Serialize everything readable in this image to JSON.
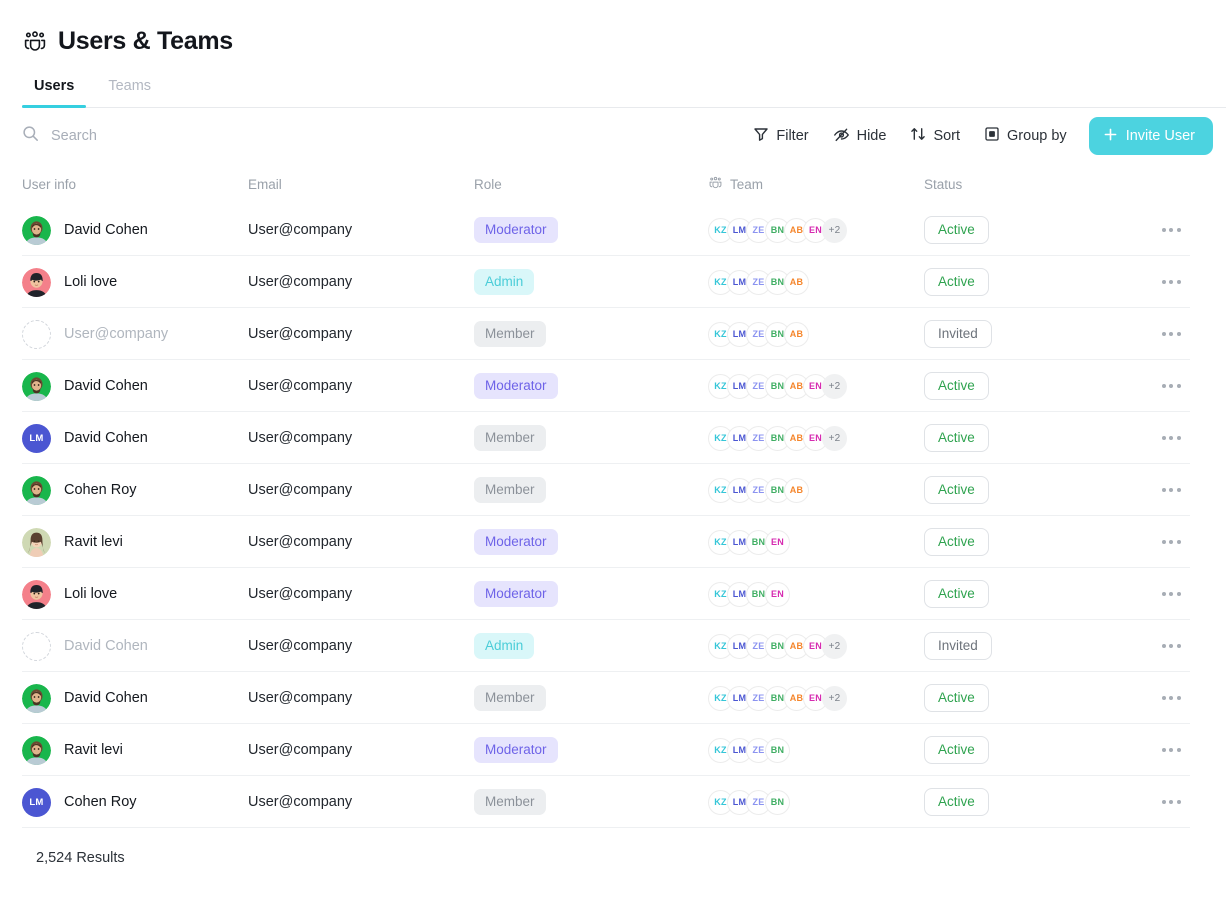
{
  "header": {
    "title": "Users & Teams",
    "icon": "users-group-icon"
  },
  "tabs": [
    {
      "label": "Users",
      "active": true
    },
    {
      "label": "Teams",
      "active": false
    }
  ],
  "search": {
    "placeholder": "Search",
    "value": "",
    "icon": "search-icon"
  },
  "toolbar": {
    "filter_label": "Filter",
    "hide_label": "Hide",
    "sort_label": "Sort",
    "group_label": "Group by",
    "invite_label": "Invite User"
  },
  "colors": {
    "accent": "#4cd3e0",
    "tab_underline": "#35cfe0",
    "role_moderator_bg": "#e6e4fd",
    "role_moderator_fg": "#6e63e8",
    "role_admin_bg": "#d9f7f9",
    "role_admin_fg": "#4bcdd8",
    "role_member_bg": "#eceef0",
    "role_member_fg": "#8b9199",
    "status_active": "#2fa34f",
    "status_invited": "#6d737b"
  },
  "team_colors": {
    "KZ": "#35c6d8",
    "LM": "#4b56d2",
    "ZE": "#8b93f0",
    "BN": "#3fae63",
    "AB": "#f5862c",
    "EN": "#d62bb0"
  },
  "table": {
    "columns": [
      {
        "key": "user",
        "label": "User info"
      },
      {
        "key": "email",
        "label": "Email"
      },
      {
        "key": "role",
        "label": "Role"
      },
      {
        "key": "team",
        "label": "Team",
        "icon": "users-group-icon"
      },
      {
        "key": "status",
        "label": "Status"
      }
    ],
    "row_menu_icon": "kebab-menu-icon",
    "rows": [
      {
        "name": "David Cohen",
        "avatar": "photo-man-green",
        "muted": false,
        "email": "User@company",
        "role": "Moderator",
        "teams": [
          "KZ",
          "LM",
          "ZE",
          "BN",
          "AB",
          "EN"
        ],
        "more": "+2",
        "status": "Active"
      },
      {
        "name": "Loli love",
        "avatar": "photo-woman-pink",
        "muted": false,
        "email": "User@company",
        "role": "Admin",
        "teams": [
          "KZ",
          "LM",
          "ZE",
          "BN",
          "AB"
        ],
        "more": "",
        "status": "Active"
      },
      {
        "name": "User@company",
        "avatar": "placeholder",
        "muted": true,
        "email": "User@company",
        "role": "Member",
        "teams": [
          "KZ",
          "LM",
          "ZE",
          "BN",
          "AB"
        ],
        "more": "",
        "status": "Invited"
      },
      {
        "name": "David Cohen",
        "avatar": "photo-man-green",
        "muted": false,
        "email": "User@company",
        "role": "Moderator",
        "teams": [
          "KZ",
          "LM",
          "ZE",
          "BN",
          "AB",
          "EN"
        ],
        "more": "+2",
        "status": "Active"
      },
      {
        "name": "David Cohen",
        "avatar": "initials-LM",
        "muted": false,
        "email": "User@company",
        "role": "Member",
        "teams": [
          "KZ",
          "LM",
          "ZE",
          "BN",
          "AB",
          "EN"
        ],
        "more": "+2",
        "status": "Active"
      },
      {
        "name": "Cohen Roy",
        "avatar": "photo-man-green",
        "muted": false,
        "email": "User@company",
        "role": "Member",
        "teams": [
          "KZ",
          "LM",
          "ZE",
          "BN",
          "AB"
        ],
        "more": "",
        "status": "Active"
      },
      {
        "name": "Ravit levi",
        "avatar": "photo-woman-long",
        "muted": false,
        "email": "User@company",
        "role": "Moderator",
        "teams": [
          "KZ",
          "LM",
          "BN",
          "EN"
        ],
        "more": "",
        "status": "Active"
      },
      {
        "name": "Loli love",
        "avatar": "photo-woman-pink",
        "muted": false,
        "email": "User@company",
        "role": "Moderator",
        "teams": [
          "KZ",
          "LM",
          "BN",
          "EN"
        ],
        "more": "",
        "status": "Active"
      },
      {
        "name": "David Cohen",
        "avatar": "placeholder",
        "muted": true,
        "email": "User@company",
        "role": "Admin",
        "teams": [
          "KZ",
          "LM",
          "ZE",
          "BN",
          "AB",
          "EN"
        ],
        "more": "+2",
        "status": "Invited"
      },
      {
        "name": "David Cohen",
        "avatar": "photo-man-green",
        "muted": false,
        "email": "User@company",
        "role": "Member",
        "teams": [
          "KZ",
          "LM",
          "ZE",
          "BN",
          "AB",
          "EN"
        ],
        "more": "+2",
        "status": "Active"
      },
      {
        "name": "Ravit levi",
        "avatar": "photo-man-green",
        "muted": false,
        "email": "User@company",
        "role": "Moderator",
        "teams": [
          "KZ",
          "LM",
          "ZE",
          "BN"
        ],
        "more": "",
        "status": "Active"
      },
      {
        "name": "Cohen Roy",
        "avatar": "initials-LM",
        "muted": false,
        "email": "User@company",
        "role": "Member",
        "teams": [
          "KZ",
          "LM",
          "ZE",
          "BN"
        ],
        "more": "",
        "status": "Active"
      }
    ]
  },
  "footer": {
    "results": "2,524 Results"
  }
}
